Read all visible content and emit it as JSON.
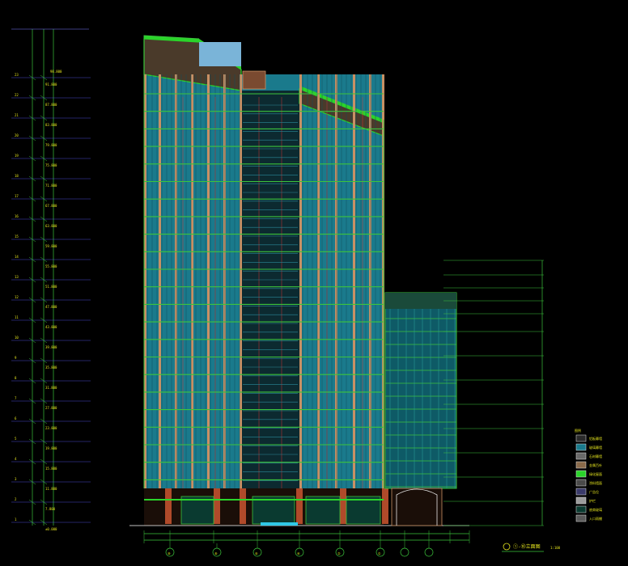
{
  "drawing": {
    "title_block": {
      "title": "①-⑩立面图",
      "scale": "1:100"
    },
    "axis_labels": [
      "⑩",
      "⑧",
      "⑥",
      "④",
      "②",
      "①"
    ],
    "floor_numbers": [
      "23",
      "22",
      "21",
      "20",
      "19",
      "18",
      "17",
      "16",
      "15",
      "14",
      "13",
      "12",
      "11",
      "10",
      "9",
      "8",
      "7",
      "6",
      "5",
      "4",
      "3",
      "2",
      "1"
    ],
    "elevations": [
      "91.800",
      "87.800",
      "83.800",
      "79.800",
      "75.800",
      "71.800",
      "67.800",
      "63.800",
      "59.800",
      "55.800",
      "51.800",
      "47.800",
      "43.800",
      "39.800",
      "35.800",
      "31.800",
      "27.800",
      "23.800",
      "19.800",
      "15.800",
      "11.800",
      "7.800",
      "±0.000"
    ],
    "legend": {
      "header": "图例",
      "items": [
        "铝板幕墙",
        "玻璃幕墙",
        "石材幕墙",
        "金属百叶",
        "绿化屋面",
        "涂料墙面",
        "广告位",
        "护栏",
        "底商玻璃",
        "入口雨棚"
      ]
    },
    "colors": {
      "glass": "#1a7a8c",
      "frame": "#3cc43c",
      "column": "#c89064",
      "mullion": "#d23232",
      "roof": "#2ad42a",
      "sky_box": "#7ab4d8",
      "dim": "#3cc43c",
      "text": "#e6e61e"
    }
  }
}
